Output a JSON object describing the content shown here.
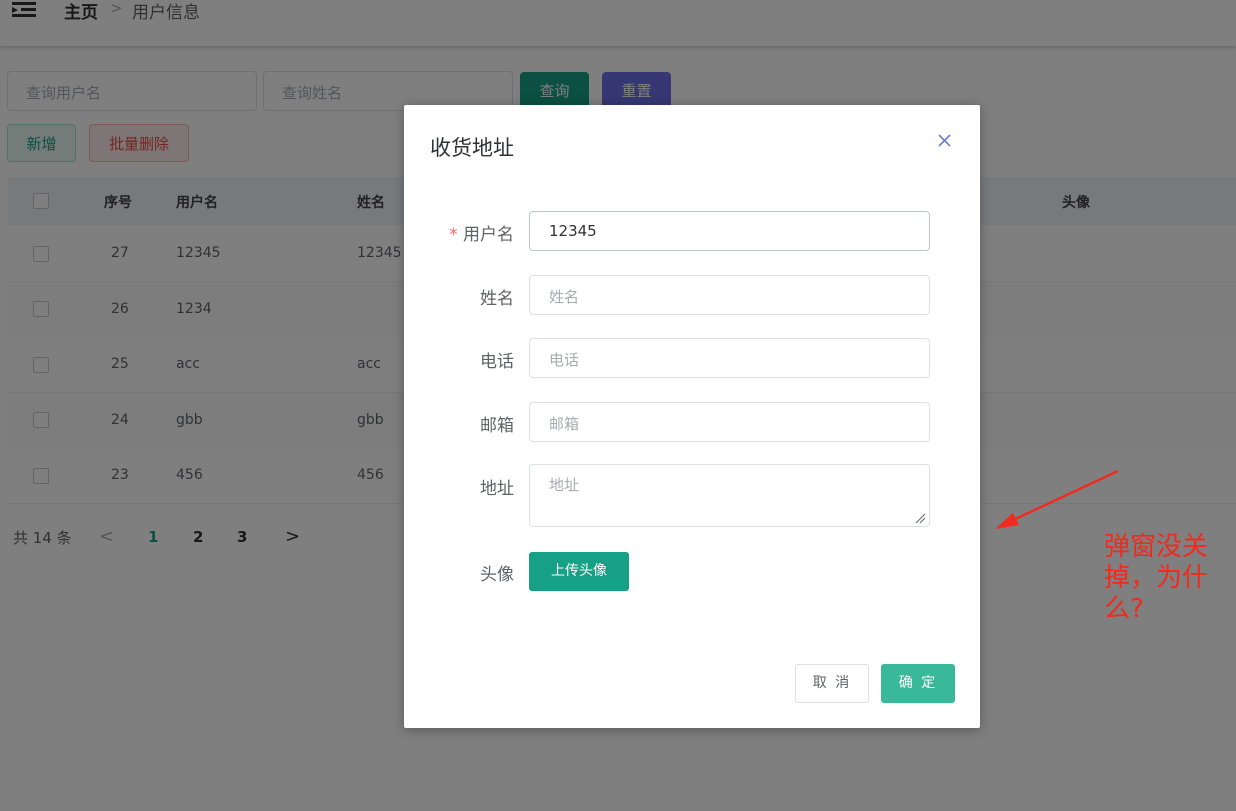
{
  "header": {
    "breadcrumb_home": "主页",
    "breadcrumb_sep": ">",
    "breadcrumb_current": "用户信息"
  },
  "search": {
    "username_placeholder": "查询用户名",
    "name_placeholder": "查询姓名",
    "query_label": "查询",
    "reset_label": "重置"
  },
  "actions": {
    "add_label": "新增",
    "batch_delete_label": "批量删除"
  },
  "table": {
    "columns": [
      "序号",
      "用户名",
      "姓名",
      "头像"
    ],
    "rows": [
      {
        "id": "27",
        "username": "12345",
        "name": "12345"
      },
      {
        "id": "26",
        "username": "1234",
        "name": ""
      },
      {
        "id": "25",
        "username": "acc",
        "name": "acc"
      },
      {
        "id": "24",
        "username": "gbb",
        "name": "gbb"
      },
      {
        "id": "23",
        "username": "456",
        "name": "456"
      }
    ]
  },
  "pagination": {
    "total": "共 14 条",
    "prev": "<",
    "pages": [
      "1",
      "2",
      "3"
    ],
    "next": ">"
  },
  "dialog": {
    "title": "收货地址",
    "close": "×",
    "required_mark": "*",
    "username_label": "用户名",
    "username_value": "12345",
    "name_label": "姓名",
    "name_placeholder": "姓名",
    "phone_label": "电话",
    "phone_placeholder": "电话",
    "email_label": "邮箱",
    "email_placeholder": "邮箱",
    "address_label": "地址",
    "address_placeholder": "地址",
    "avatar_label": "头像",
    "upload_label": "上传头像",
    "cancel_label": "取 消",
    "ok_label": "确 定"
  },
  "annotation": {
    "text": "弹窗没关掉，为什么?"
  },
  "colors": {
    "primary": "#16a085",
    "reset": "#6c6fe6",
    "annotation": "#f02a1e"
  }
}
